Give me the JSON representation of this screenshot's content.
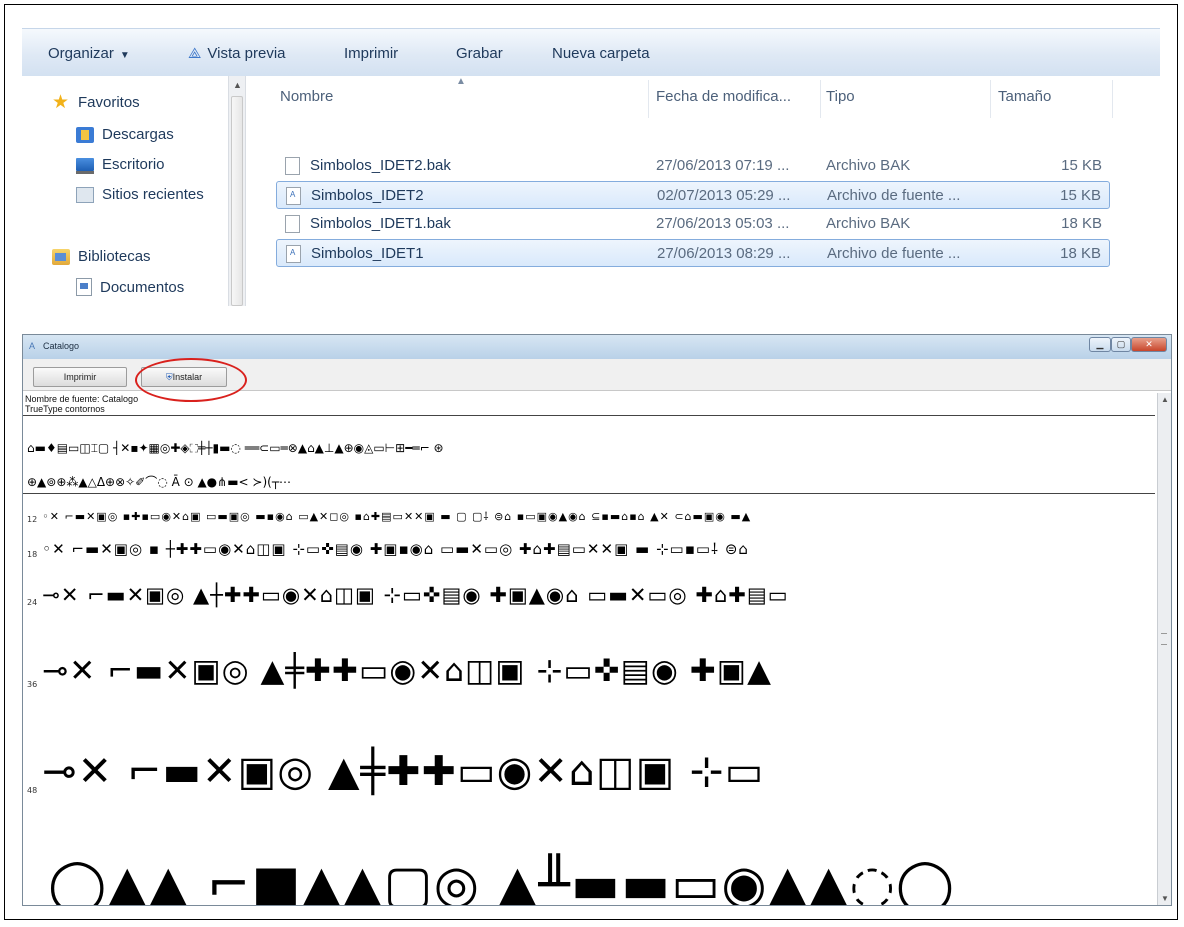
{
  "explorer": {
    "toolbar": {
      "organize": "Organizar",
      "preview": "Vista previa",
      "print": "Imprimir",
      "burn": "Grabar",
      "new_folder": "Nueva carpeta"
    },
    "nav": {
      "favorites": "Favoritos",
      "downloads": "Descargas",
      "desktop": "Escritorio",
      "recent": "Sitios recientes",
      "libraries": "Bibliotecas",
      "documents": "Documentos"
    },
    "columns": {
      "name": "Nombre",
      "date": "Fecha de modifica...",
      "type": "Tipo",
      "size": "Tamaño"
    },
    "files": [
      {
        "name": "Simbolos_IDET2.bak",
        "date": "27/06/2013 07:19 ...",
        "type": "Archivo BAK",
        "size": "15 KB",
        "selected": false
      },
      {
        "name": "Simbolos_IDET2",
        "date": "02/07/2013 05:29 ...",
        "type": "Archivo de fuente ...",
        "size": "15 KB",
        "selected": true
      },
      {
        "name": "Simbolos_IDET1.bak",
        "date": "27/06/2013 05:03 ...",
        "type": "Archivo BAK",
        "size": "18 KB",
        "selected": false
      },
      {
        "name": "Simbolos_IDET1",
        "date": "27/06/2013 08:29 ...",
        "type": "Archivo de fuente ...",
        "size": "18 KB",
        "selected": true
      }
    ]
  },
  "catalog": {
    "title": "Catalogo",
    "print_button": "Imprimir",
    "install_button": "Instalar",
    "font_name_line": "Nombre de fuente: Catalogo",
    "font_type_line": "TrueType  contornos",
    "charset_row1": "⌂▬♦▤▭◫⌶▢ ┤✕▪✦▦◎✚◈⛶╪┼▮▬◌ ══⊂▭═⊗▲⌂▲⊥▲⊕◉◬▭⊢⊞━═⌐ ⊛",
    "charset_row2": "⊕▲⊚⊕⁂▲△Δ⊕⊗✧✐⌒◌ Ā ⊙ ▲●⋔▬< ≻)(┬⋯",
    "sample_rows": [
      {
        "size": "12",
        "glyphs": "◦✕  ⌐▬✕▣◎ ▪✚▪▭◉✕⌂▣ ▭▬▣◎ ▬▪◉⌂ ▭▲✕◻◎ ▪⌂✚▤▭✕✕▣ ▬  ▢ ▢⸸ ⊜⌂ ▪▭▣◉▲◉⌂ ⊆▪▬⌂▪⌂ ▲✕ ⊂⌂▬▣◉ ▬▲"
      },
      {
        "size": "18",
        "glyphs": "◦✕  ⌐▬✕▣◎  ▪ ┼✚✚▭◉✕⌂◫▣  ⊹▭✜▤◉  ✚▣▪◉⌂  ▭▬✕▭◎  ✚⌂✚▤▭✕✕▣  ▬  ⊹▭▪▭⸸  ⊜⌂"
      },
      {
        "size": "24",
        "glyphs": "⊸✕  ⌐▬✕▣◎  ▲┼✚✚▭◉✕⌂◫▣  ⊹▭✜▤◉  ✚▣▲◉⌂  ▭▬✕▭◎  ✚⌂✚▤▭"
      },
      {
        "size": "36",
        "glyphs": "⊸✕  ⌐▬✕▣◎  ▲╪✚✚▭◉✕⌂◫▣  ⊹▭✜▤◉  ✚▣▲"
      },
      {
        "size": "48",
        "glyphs": "⊸✕  ⌐▬✕▣◎  ▲╪✚✚▭◉✕⌂◫▣  ⊹▭"
      },
      {
        "size": "",
        "glyphs": "◯▲▲  ⌐■▲▲▢◎  ▲╨▬▬▭◉▲▲◌◯"
      }
    ]
  }
}
